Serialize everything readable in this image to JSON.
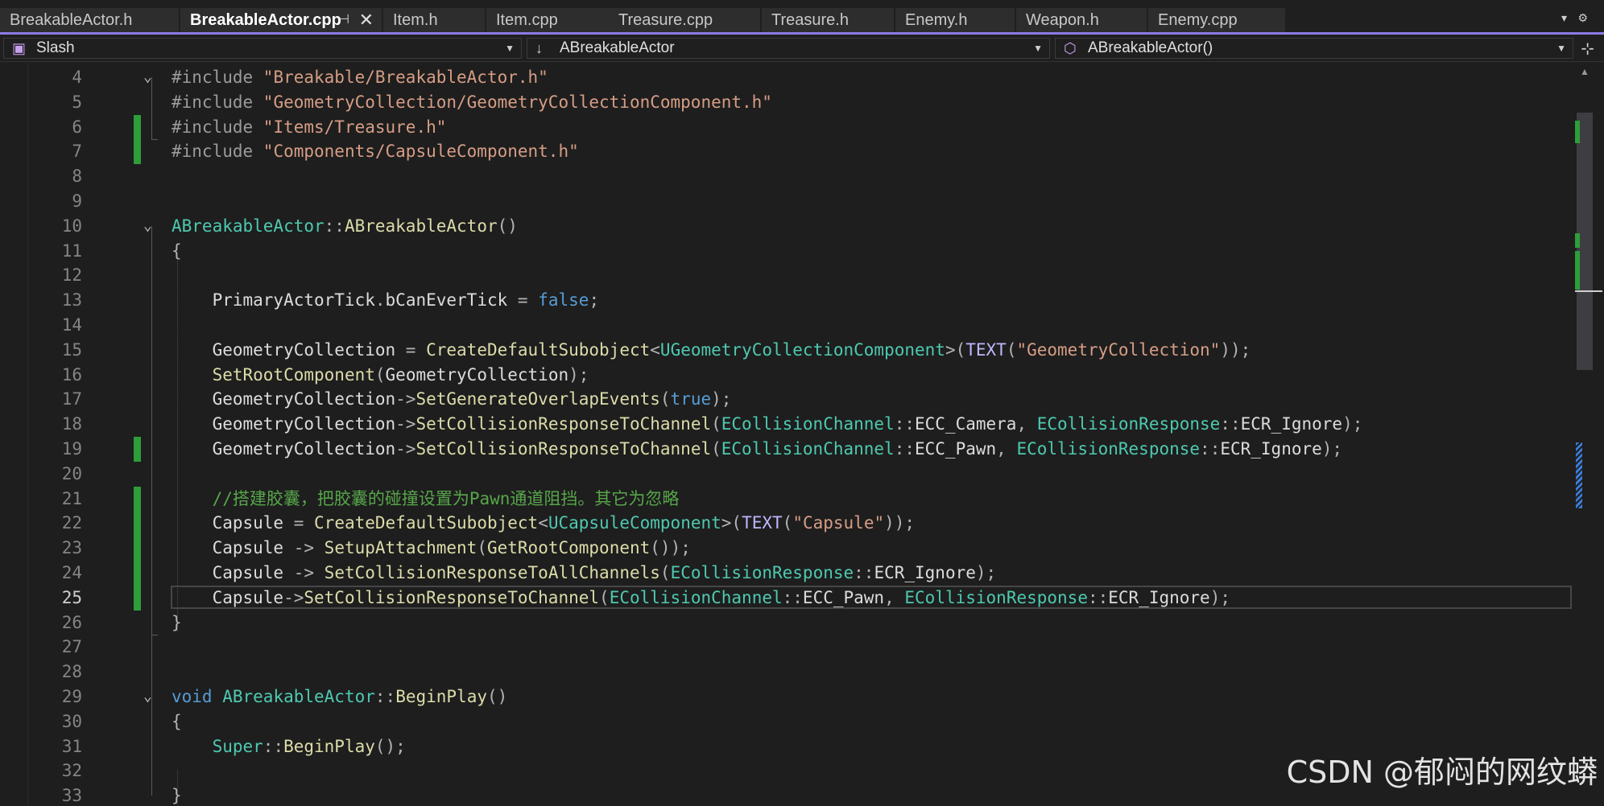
{
  "tabs": [
    {
      "label": "BreakableActor.h",
      "active": false
    },
    {
      "label": "BreakableActor.cpp",
      "active": true
    },
    {
      "label": "Item.h",
      "active": false
    },
    {
      "label": "Item.cpp",
      "active": false
    },
    {
      "label": "Treasure.cpp",
      "active": false
    },
    {
      "label": "Treasure.h",
      "active": false
    },
    {
      "label": "Enemy.h",
      "active": false
    },
    {
      "label": "Weapon.h",
      "active": false
    },
    {
      "label": "Enemy.cpp",
      "active": false
    }
  ],
  "nav": {
    "project": "Slash",
    "scope": "ABreakableActor",
    "member": "ABreakableActor()"
  },
  "editor": {
    "current_line": 25,
    "lines": [
      {
        "n": "4",
        "text": "#include \"Breakable/BreakableActor.h\""
      },
      {
        "n": "5",
        "text": "#include \"GeometryCollection/GeometryCollectionComponent.h\""
      },
      {
        "n": "6",
        "text": "#include \"Items/Treasure.h\""
      },
      {
        "n": "7",
        "text": "#include \"Components/CapsuleComponent.h\""
      },
      {
        "n": "8",
        "text": ""
      },
      {
        "n": "9",
        "text": ""
      },
      {
        "n": "10",
        "text": "ABreakableActor::ABreakableActor()"
      },
      {
        "n": "11",
        "text": "{"
      },
      {
        "n": "12",
        "text": ""
      },
      {
        "n": "13",
        "text": "    PrimaryActorTick.bCanEverTick = false;"
      },
      {
        "n": "14",
        "text": ""
      },
      {
        "n": "15",
        "text": "    GeometryCollection = CreateDefaultSubobject<UGeometryCollectionComponent>(TEXT(\"GeometryCollection\"));"
      },
      {
        "n": "16",
        "text": "    SetRootComponent(GeometryCollection);"
      },
      {
        "n": "17",
        "text": "    GeometryCollection->SetGenerateOverlapEvents(true);"
      },
      {
        "n": "18",
        "text": "    GeometryCollection->SetCollisionResponseToChannel(ECollisionChannel::ECC_Camera, ECollisionResponse::ECR_Ignore);"
      },
      {
        "n": "19",
        "text": "    GeometryCollection->SetCollisionResponseToChannel(ECollisionChannel::ECC_Pawn, ECollisionResponse::ECR_Ignore);"
      },
      {
        "n": "20",
        "text": ""
      },
      {
        "n": "21",
        "text": "    //搭建胶囊，把胶囊的碰撞设置为Pawn通道阻挡。其它为忽略"
      },
      {
        "n": "22",
        "text": "    Capsule = CreateDefaultSubobject<UCapsuleComponent>(TEXT(\"Capsule\"));"
      },
      {
        "n": "23",
        "text": "    Capsule -> SetupAttachment(GetRootComponent());"
      },
      {
        "n": "24",
        "text": "    Capsule -> SetCollisionResponseToAllChannels(ECollisionResponse::ECR_Ignore);"
      },
      {
        "n": "25",
        "text": "    Capsule->SetCollisionResponseToChannel(ECollisionChannel::ECC_Pawn, ECollisionResponse::ECR_Ignore);"
      },
      {
        "n": "26",
        "text": "}"
      },
      {
        "n": "27",
        "text": ""
      },
      {
        "n": "28",
        "text": ""
      },
      {
        "n": "29",
        "text": "void ABreakableActor::BeginPlay()"
      },
      {
        "n": "30",
        "text": "{"
      },
      {
        "n": "31",
        "text": "    Super::BeginPlay();"
      },
      {
        "n": "32",
        "text": ""
      },
      {
        "n": "33",
        "text": "}"
      }
    ]
  },
  "watermark": "CSDN @郁闷的网纹蟒",
  "colors": {
    "accent": "#8c7ae6",
    "change_marker": "#2d9e3a",
    "keyword": "#569cd6",
    "string": "#d69d85",
    "type": "#4ec9b0",
    "function": "#dcdcaa",
    "comment": "#57a64a"
  }
}
